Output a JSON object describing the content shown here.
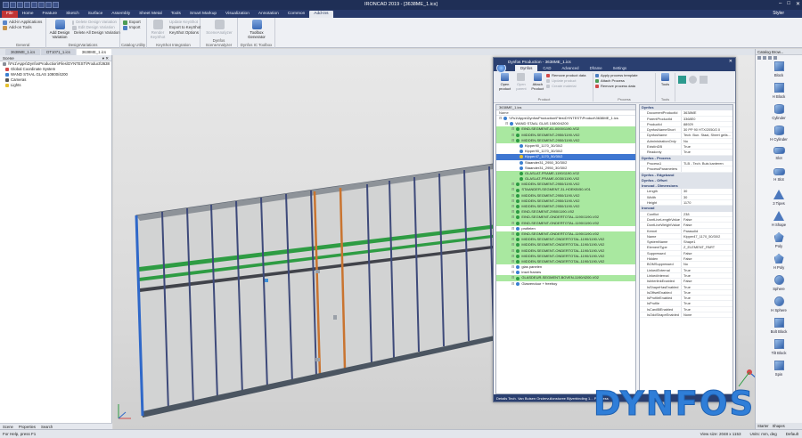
{
  "window": {
    "title": "IRONCAD 2019 - [3638ME_1.ics]",
    "user": "Styler"
  },
  "ribbon_tabs": [
    "File",
    "Home",
    "Feature",
    "Sketch",
    "Surface",
    "Assembly",
    "Sheet Metal",
    "Tools",
    "Smart Markup",
    "Visualization",
    "Annotation",
    "Common",
    "Add-ins"
  ],
  "ribbon": {
    "general": {
      "label": "General",
      "add_apps": "Add-in Applications",
      "add_tools": "Add-on Tools"
    },
    "design_variations": {
      "label": "DesignVariations",
      "add_variation": "Add Design Variation",
      "delete_variation": "Delete Design Variation",
      "edit_variation": "Edit Design Variation",
      "delete_all": "Delete All Design Variation"
    },
    "catalog_utility": {
      "label": "Catalog Utility",
      "export": "Export",
      "import": "Import"
    },
    "keyshot": {
      "label": "KeyShot Integration",
      "render": "Render KeyShot",
      "update": "Update KeyShot",
      "export": "Export to KeyShot",
      "options": "KeyShot Options"
    },
    "dynfos_scene": {
      "label": "Dynfos SceneAnalyzer",
      "btn": "SceneAnalyzer"
    },
    "dynfos_toolbox": {
      "label": "Dynfos IC Toolbox",
      "btn": "Toolbox Generator"
    }
  },
  "doc_tabs": [
    "3638ME_1.ics",
    "DT1071_1.ics",
    "3638ME_1.ics"
  ],
  "scene": {
    "title": "Scene",
    "path": "\\\\Fs1\\Apps\\DynfosProduction\\Files\\DYNTEST\\Product\\3638",
    "items": [
      "Global Coordinate System",
      "WAND STAAL GLAS 10800/4200",
      "Cameras",
      "Lights"
    ],
    "tabs": [
      "Scene",
      "Properties",
      "Search"
    ]
  },
  "catalog": {
    "title": "Catalog Brow...",
    "items": [
      "Block",
      "H Block",
      "Cylinder",
      "H Cylinder",
      "Slot",
      "H Slot",
      "3 Tipes",
      "H Shape",
      "Poly",
      "H Poly",
      "Sphere",
      "H Sphere",
      "Bolt Block",
      "Tilt Block",
      "Spin"
    ],
    "tabs": [
      "Starter",
      "Shapes"
    ]
  },
  "dialog": {
    "title": "Dynfos Production - 3638ME_1.ics",
    "tabs": [
      "Dynfos",
      "CAD",
      "Advanced",
      "Dframe",
      "Settings"
    ],
    "groups": {
      "product": {
        "label": "Product",
        "open": "Open product",
        "open_parent": "Open parent",
        "attach": "Attach Product",
        "remove_data": "Remove product data",
        "update": "Update product",
        "create_material": "Create material"
      },
      "process": {
        "label": "Process",
        "apply_template": "Apply process template",
        "attach_process": "Attach Process",
        "remove_process": "Remove process data"
      },
      "tools": {
        "label": "Tools",
        "btn": "Tools"
      }
    },
    "tree_tab": "3638ME_1.ics",
    "tree_header": "Name",
    "tree": [
      {
        "t": "\\\\Fs1\\Apps\\DynfosProduction\\Files\\DYNTEST\\Product\\3638ME_1.ics",
        "lvl": 0,
        "s": ""
      },
      {
        "t": "WAND STAAL GLAS 10800/4200",
        "lvl": 1,
        "s": ""
      },
      {
        "t": "EIND-SEGMENT-61-0000/1190-V02",
        "lvl": 2,
        "s": "green"
      },
      {
        "t": "MIDDEN-SEGMENT-2950/1190-V02",
        "lvl": 2,
        "s": "green"
      },
      {
        "t": "MIDDEN-SEGMENT-2950/1190-V02",
        "lvl": 2,
        "s": "green"
      },
      {
        "t": "Kipper90_1170_30/30/2",
        "lvl": 3,
        "s": ""
      },
      {
        "t": "Kipper90_1170_30/30/2",
        "lvl": 3,
        "s": ""
      },
      {
        "t": "Kipper47_1170_50/30/2",
        "lvl": 3,
        "s": "sel"
      },
      {
        "t": "Staander31_2950_30/30/2",
        "lvl": 3,
        "s": ""
      },
      {
        "t": "Staander31_2950_30/30/2",
        "lvl": 3,
        "s": ""
      },
      {
        "t": "GLASLAT-FRAME-1190/1190-V02",
        "lvl": 3,
        "s": "green"
      },
      {
        "t": "GLASLAT-FRAME-0030/1190-V02",
        "lvl": 3,
        "s": "green"
      },
      {
        "t": "MIDDEN-SEGMENT-2950/1190-V02",
        "lvl": 2,
        "s": "green"
      },
      {
        "t": "STAANDER-SEGMENT-31-HOEKB/50-V01",
        "lvl": 2,
        "s": "green"
      },
      {
        "t": "MIDDEN-SEGMENT-2950/1190-V02",
        "lvl": 2,
        "s": "green"
      },
      {
        "t": "MIDDEN-SEGMENT-2950/1190-V02",
        "lvl": 2,
        "s": "green"
      },
      {
        "t": "MIDDEN-SEGMENT-2950/1190-V02",
        "lvl": 2,
        "s": "green"
      },
      {
        "t": "EIND-SEGMENT-2950/1190-V02",
        "lvl": 2,
        "s": "green"
      },
      {
        "t": "EIND-SEGMENT-ONDERTOTAL-1190/1190-V02",
        "lvl": 2,
        "s": "green"
      },
      {
        "t": "EIND-SEGMENT-ONDERTOTAL-1190/1190-V02",
        "lvl": 2,
        "s": "green"
      },
      {
        "t": "profielen",
        "lvl": 2,
        "s": ""
      },
      {
        "t": "EIND-SEGMENT-ONDERTOTAL-1190/1190-V02",
        "lvl": 2,
        "s": "green"
      },
      {
        "t": "MIDDEN-SEGMENT-ONDERTOTAL-1190/1190-V02",
        "lvl": 2,
        "s": "green"
      },
      {
        "t": "MIDDEN-SEGMENT-ONDERTOTAL-1190/1190-V02",
        "lvl": 2,
        "s": "green"
      },
      {
        "t": "MIDDEN-SEGMENT-ONDERTOTAL-1190/1190-V02",
        "lvl": 2,
        "s": "green"
      },
      {
        "t": "MIDDEN-SEGMENT-ONDERTOTAL-1190/1190-V02",
        "lvl": 2,
        "s": "green"
      },
      {
        "t": "MIDDEN-SEGMENT-ONDERTOTAL-1190/1190-V02",
        "lvl": 2,
        "s": "green"
      },
      {
        "t": "glas panelen",
        "lvl": 2,
        "s": ""
      },
      {
        "t": "inset frames",
        "lvl": 2,
        "s": ""
      },
      {
        "t": "GLASDEUR-SEGMENT-BOVEN-1190/4200-V02",
        "lvl": 2,
        "s": "green"
      },
      {
        "t": "Glasrenduur + freeboy",
        "lvl": 2,
        "s": ""
      }
    ],
    "props": [
      {
        "sec": "Dynfos"
      },
      {
        "k": "DocumentProductId",
        "v": "3638ME"
      },
      {
        "k": "ParentProductId",
        "v": "3368E0"
      },
      {
        "k": "ProductId",
        "v": "88929"
      },
      {
        "k": "DynfosNameShort",
        "v": "30 PP 90 HTX/2050/2.0"
      },
      {
        "k": "DynfosName",
        "v": "Tech. Bun. Staal, Sheet gelis..."
      },
      {
        "k": "AdministrationOnly",
        "v": "No"
      },
      {
        "k": "ExistInDB",
        "v": "True"
      },
      {
        "k": "Readonly",
        "v": "True"
      },
      {
        "sec": "Dynfos - Process"
      },
      {
        "k": "Process1",
        "v": "TLB - Tech. Buis kanteren"
      },
      {
        "k": "ProcessParameters",
        "v": ""
      },
      {
        "sec": "Dynfos - Edgeband"
      },
      {
        "sec": "Dynfos - Offset"
      },
      {
        "sec": "Ironcad - Dimensions"
      },
      {
        "k": "Length",
        "v": "30"
      },
      {
        "k": "Width",
        "v": "30"
      },
      {
        "k": "Height",
        "v": "1170"
      },
      {
        "sec": "Ironcad"
      },
      {
        "k": "Conflict",
        "v": "238"
      },
      {
        "k": "DontLiveLengthValue",
        "v": "False"
      },
      {
        "k": "DontLiveWeightValue",
        "v": "False"
      },
      {
        "k": "Kernel",
        "v": "Parasolid"
      },
      {
        "k": "Name",
        "v": "Kipper47_1170_50/30/2"
      },
      {
        "k": "SystemName",
        "v": "Shape1"
      },
      {
        "k": "ElementType",
        "v": "Z_ELEMENT_PART"
      },
      {
        "k": "Suppressed",
        "v": "False"
      },
      {
        "k": "Hidden",
        "v": "False"
      },
      {
        "k": "BOMSuppressed",
        "v": "No"
      },
      {
        "k": "LinkedExternal",
        "v": "True"
      },
      {
        "k": "LinkedInternal",
        "v": "True"
      },
      {
        "k": "IsInterlinkEnabled",
        "v": "False"
      },
      {
        "k": "IsShapeHasEnabled",
        "v": "True"
      },
      {
        "k": "IsOffsetEnabled",
        "v": "True"
      },
      {
        "k": "IsProfileEnabled",
        "v": "True"
      },
      {
        "k": "IsProfile",
        "v": "True"
      },
      {
        "k": "IsCardBlEnabled",
        "v": "True"
      },
      {
        "k": "IsOddShapeEnabled",
        "v": "None"
      }
    ],
    "status": "Details  Tech. Van Buisen Ondervullonsturee Bijverbinding 1... Progress"
  },
  "status": {
    "left": "For Help, press F1",
    "view": "View size: 2048 x 1153",
    "units": "Units: mm, deg",
    "mode": "Default"
  },
  "logo": "DYNFOS"
}
